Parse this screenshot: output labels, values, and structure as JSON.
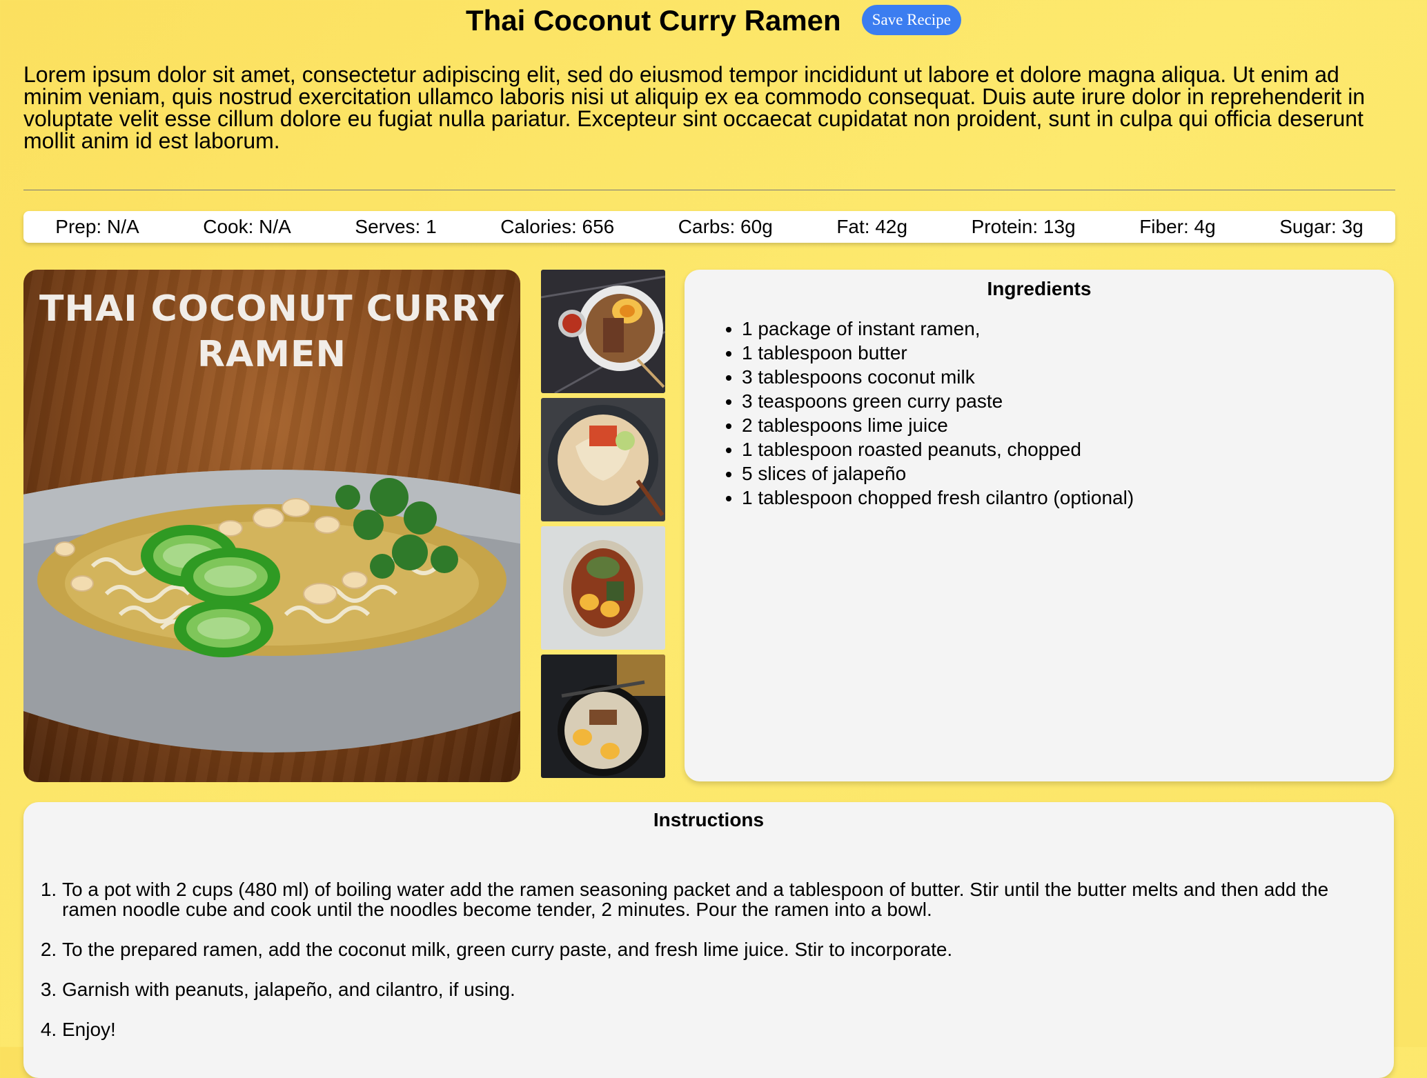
{
  "recipe": {
    "title": "Thai Coconut Curry Ramen",
    "save_label": "Save Recipe",
    "description": "Lorem ipsum dolor sit amet, consectetur adipiscing elit, sed do eiusmod tempor incididunt ut labore et dolore magna aliqua. Ut enim ad minim veniam, quis nostrud exercitation ullamco laboris nisi ut aliquip ex ea commodo consequat. Duis aute irure dolor in reprehenderit in voluptate velit esse cillum dolore eu fugiat nulla pariatur. Excepteur sint occaecat cupidatat non proident, sunt in culpa qui officia deserunt mollit anim id est laborum."
  },
  "stats": [
    "Prep: N/A",
    "Cook: N/A",
    "Serves: 1",
    "Calories: 656",
    "Carbs: 60g",
    "Fat: 42g",
    "Protein: 13g",
    "Fiber: 4g",
    "Sugar: 3g"
  ],
  "hero": {
    "title_line1": "THAI COCONUT CURRY",
    "title_line2": "RAMEN"
  },
  "ingredients": {
    "heading": "Ingredients",
    "items": [
      "1 package of instant ramen,",
      "1 tablespoon butter",
      "3 tablespoons coconut milk",
      "3 teaspoons green curry paste",
      "2 tablespoons lime juice",
      "1 tablespoon roasted peanuts, chopped",
      "5 slices of jalapeño",
      "1 tablespoon chopped fresh cilantro (optional)"
    ]
  },
  "instructions": {
    "heading": "Instructions",
    "steps": [
      "To a pot with 2 cups (480 ml) of boiling water add the ramen seasoning packet and a tablespoon of butter. Stir until the butter melts and then add the ramen noodle cube and cook until the noodles become tender, 2 minutes. Pour the ramen into a bowl.",
      "To the prepared ramen, add the coconut milk, green curry paste, and fresh lime juice. Stir to incorporate.",
      "Garnish with peanuts, jalapeño, and cilantro, if using.",
      "Enjoy!"
    ]
  },
  "colors": {
    "background": "#fbe466",
    "accent_button": "#3b7df0",
    "panel": "#f4f4f4"
  }
}
